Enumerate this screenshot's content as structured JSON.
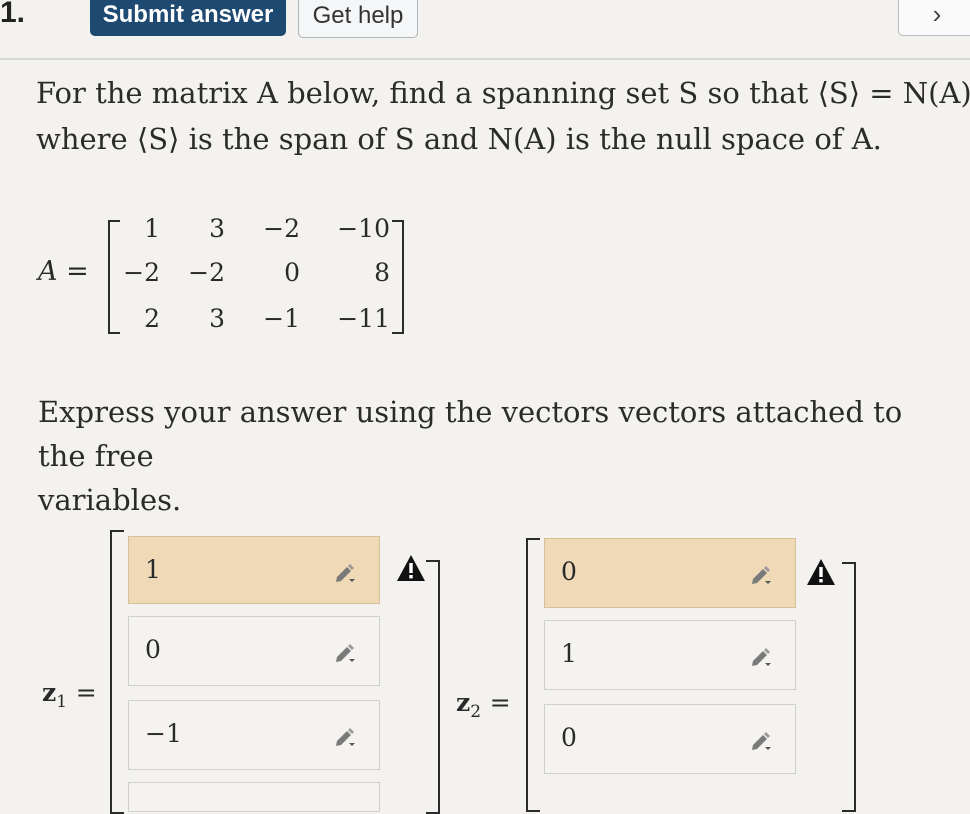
{
  "toolbar": {
    "question_number": "1.",
    "submit_label": "Submit answer",
    "help_label": "Get help",
    "next_label": "›"
  },
  "prompt": {
    "line1": "For the matrix A below, find a spanning set S so that ⟨S⟩ = N(A),",
    "line2": "where ⟨S⟩ is the span of S and N(A) is the null space of A."
  },
  "matrix": {
    "label": "A =",
    "rows": [
      [
        "1",
        "3",
        "−2",
        "−10"
      ],
      [
        "−2",
        "−2",
        "0",
        "8"
      ],
      [
        "2",
        "3",
        "−1",
        "−11"
      ]
    ]
  },
  "instruction": {
    "line1": "Express your answer using the vectors vectors attached to the free",
    "line2": "variables."
  },
  "vectors": [
    {
      "label": "z",
      "subscript": "1",
      "equals": "=",
      "entries": [
        {
          "value": "1",
          "warning": true
        },
        {
          "value": "0",
          "warning": false
        },
        {
          "value": "−1",
          "warning": false
        }
      ]
    },
    {
      "label": "z",
      "subscript": "2",
      "equals": "=",
      "entries": [
        {
          "value": "0",
          "warning": true
        },
        {
          "value": "1",
          "warning": false
        },
        {
          "value": "0",
          "warning": false
        }
      ]
    }
  ],
  "colors": {
    "submit_bg": "#1e4a72",
    "warning_cell_bg": "#efd9b7",
    "warning_icon": "#111111"
  },
  "icons": {
    "edit": "pencil-edit-icon",
    "warning": "warning-triangle-icon"
  }
}
